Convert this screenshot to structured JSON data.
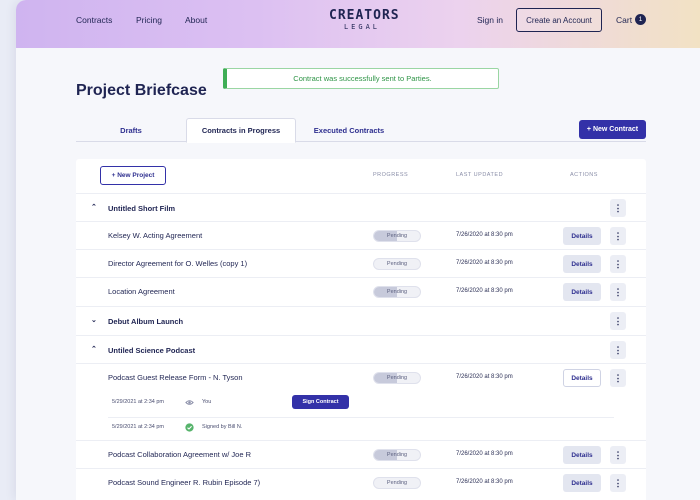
{
  "nav": {
    "contracts": "Contracts",
    "pricing": "Pricing",
    "about": "About",
    "logo_top": "CREATORS",
    "logo_bottom": "LEGAL",
    "sign_in": "Sign in",
    "create_account": "Create an Account",
    "cart": "Cart",
    "cart_count": "1"
  },
  "page": {
    "title": "Project Briefcase",
    "toast": "Contract was successfully sent to Parties."
  },
  "tabs": {
    "drafts": "Drafts",
    "in_progress": "Contracts in Progress",
    "executed": "Executed Contracts",
    "new_contract": "+ New Contract"
  },
  "table": {
    "new_project": "+ New Project",
    "headers": {
      "progress": "PROGRESS",
      "last_updated": "LAST UPDATED",
      "actions": "ACTIONS"
    },
    "details_label": "Details",
    "groups": [
      {
        "name": "Untitled Short Film",
        "expanded": true,
        "items": [
          {
            "name": "Kelsey W. Acting Agreement",
            "status": "Pending",
            "progress": 0.5,
            "updated": "7/26/2020 at 8:30 pm"
          },
          {
            "name": "Director Agreement for O. Welles (copy 1)",
            "status": "Pending",
            "progress": 0.0,
            "updated": "7/26/2020 at 8:30 pm"
          },
          {
            "name": "Location Agreement",
            "status": "Pending",
            "progress": 0.5,
            "updated": "7/26/2020 at 8:30 pm"
          }
        ]
      },
      {
        "name": "Debut Album Launch",
        "expanded": false,
        "items": []
      },
      {
        "name": "Untiled Science Podcast",
        "expanded": true,
        "items": [
          {
            "name": "Podcast Guest Release Form - N. Tyson",
            "status": "Pending",
            "progress": 0.5,
            "updated": "7/26/2020 at 8:30 pm",
            "signers": [
              {
                "time": "5/29/2021 at 2:34 pm",
                "icon": "eye-icon",
                "who": "You",
                "action": "Sign Contract"
              },
              {
                "time": "5/29/2021 at 2:34 pm",
                "icon": "check-circle-icon",
                "who": "Signed  by Bill N."
              }
            ]
          },
          {
            "name": "Podcast Collaboration Agreement w/ Joe R",
            "status": "Pending",
            "progress": 0.5,
            "updated": "7/26/2020 at 8:30 pm"
          },
          {
            "name": "Podcast Sound Engineer R. Rubin Episode 7)",
            "status": "Pending",
            "progress": 0.0,
            "updated": "7/26/2020 at 8:30 pm"
          }
        ]
      }
    ]
  },
  "colors": {
    "accent": "#3331a8",
    "navy": "#1f2452",
    "success": "#3fae56"
  }
}
